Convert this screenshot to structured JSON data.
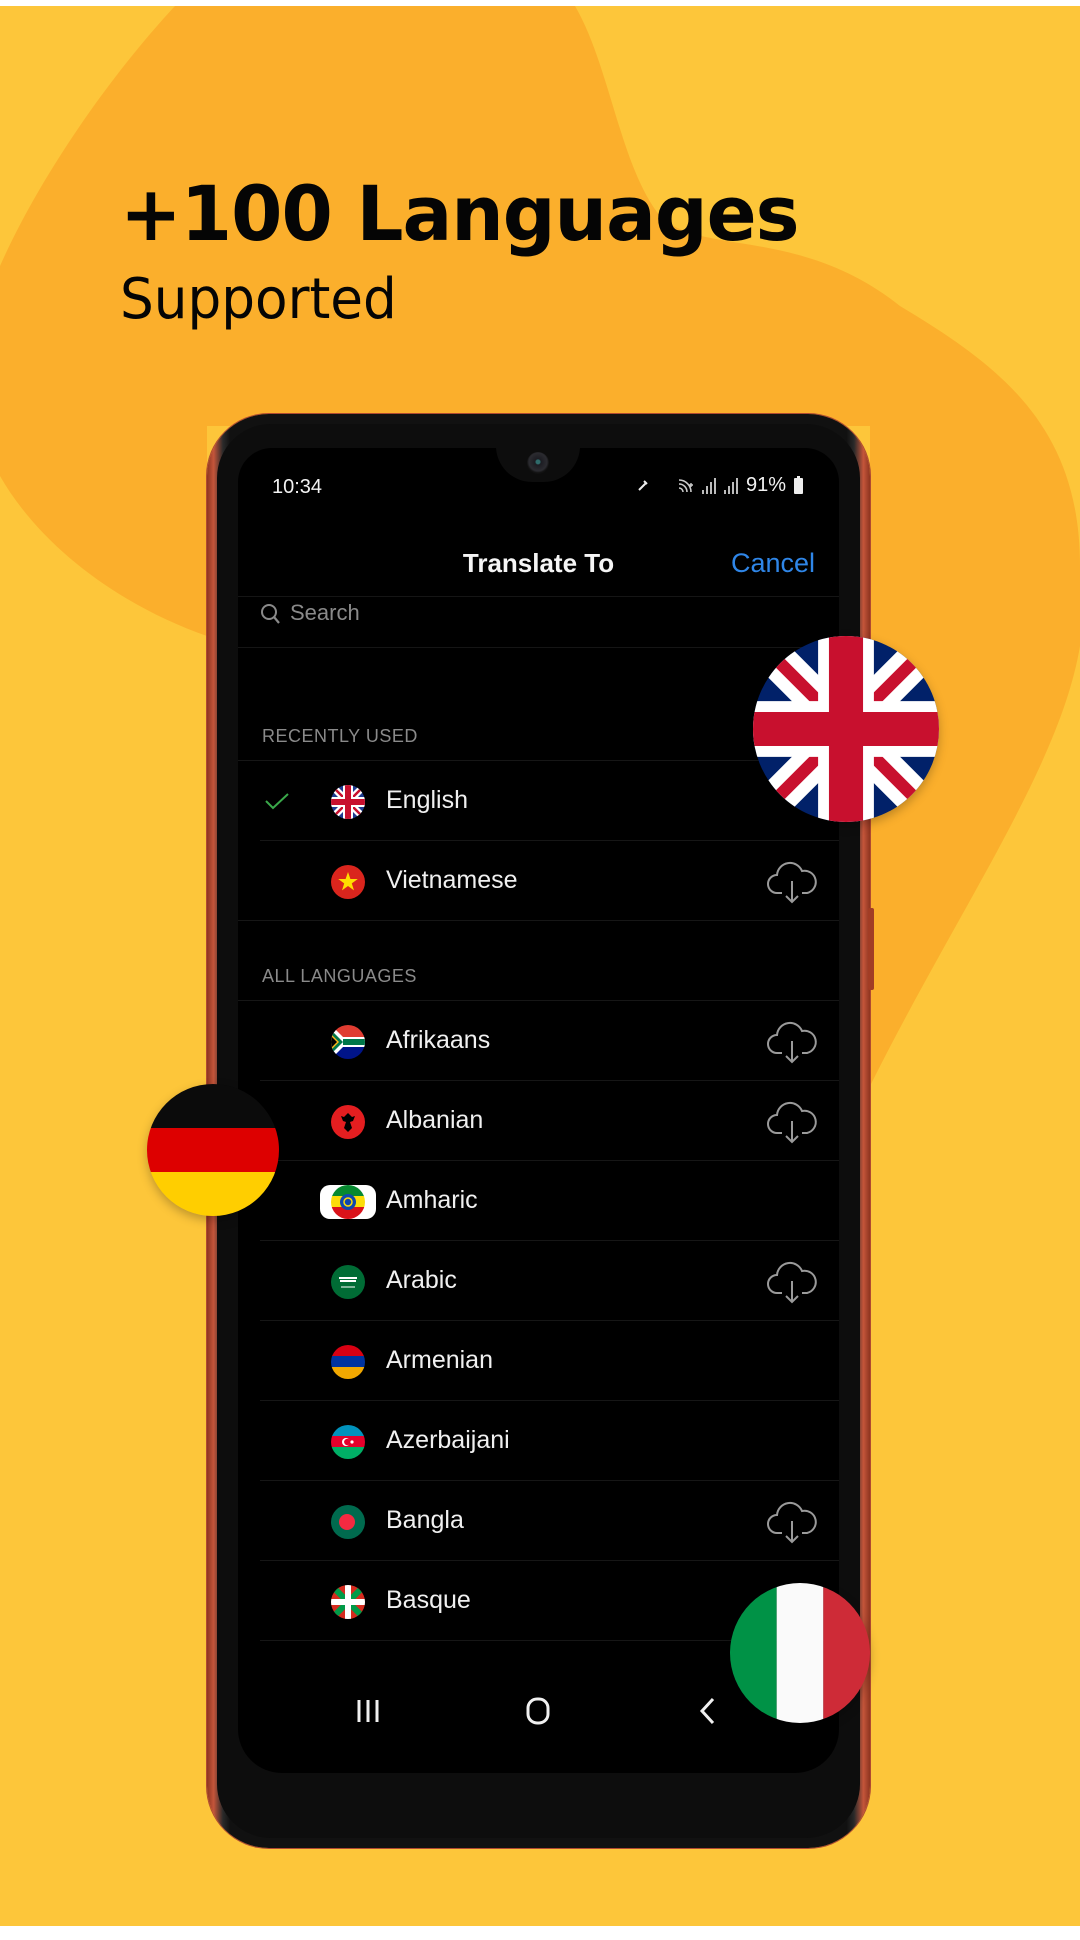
{
  "promo": {
    "headline": "+100 Languages",
    "subline": "Supported",
    "colors": {
      "background": "#FDC63A",
      "blob": "#FBAF2C",
      "text": "#050505"
    }
  },
  "status_bar": {
    "time": "10:34",
    "battery": "91%",
    "icons": [
      "bluetooth-icon",
      "wifi-calling-icon",
      "signal-icon",
      "signal-icon",
      "battery-icon"
    ]
  },
  "header": {
    "title": "Translate To",
    "cancel_label": "Cancel",
    "accent_color": "#2F86E8"
  },
  "search": {
    "placeholder": "Search",
    "icon": "search-icon"
  },
  "sections": {
    "recent": {
      "title": "RECENTLY USED",
      "items": [
        {
          "label": "English",
          "flag": "uk",
          "selected": true,
          "downloadable": false
        },
        {
          "label": "Vietnamese",
          "flag": "vn",
          "selected": false,
          "downloadable": true
        }
      ]
    },
    "all": {
      "title": "ALL LANGUAGES",
      "items": [
        {
          "label": "Afrikaans",
          "flag": "za",
          "downloadable": true
        },
        {
          "label": "Albanian",
          "flag": "al",
          "downloadable": true
        },
        {
          "label": "Amharic",
          "flag": "et",
          "downloadable": false
        },
        {
          "label": "Arabic",
          "flag": "sa",
          "downloadable": true
        },
        {
          "label": "Armenian",
          "flag": "am",
          "downloadable": false
        },
        {
          "label": "Azerbaijani",
          "flag": "az",
          "downloadable": false
        },
        {
          "label": "Bangla",
          "flag": "bd",
          "downloadable": true
        },
        {
          "label": "Basque",
          "flag": "eu",
          "downloadable": false
        }
      ]
    }
  },
  "navbar": {
    "buttons": [
      "recent-apps",
      "home",
      "back"
    ]
  },
  "decor_flags": [
    "uk",
    "de",
    "it"
  ]
}
